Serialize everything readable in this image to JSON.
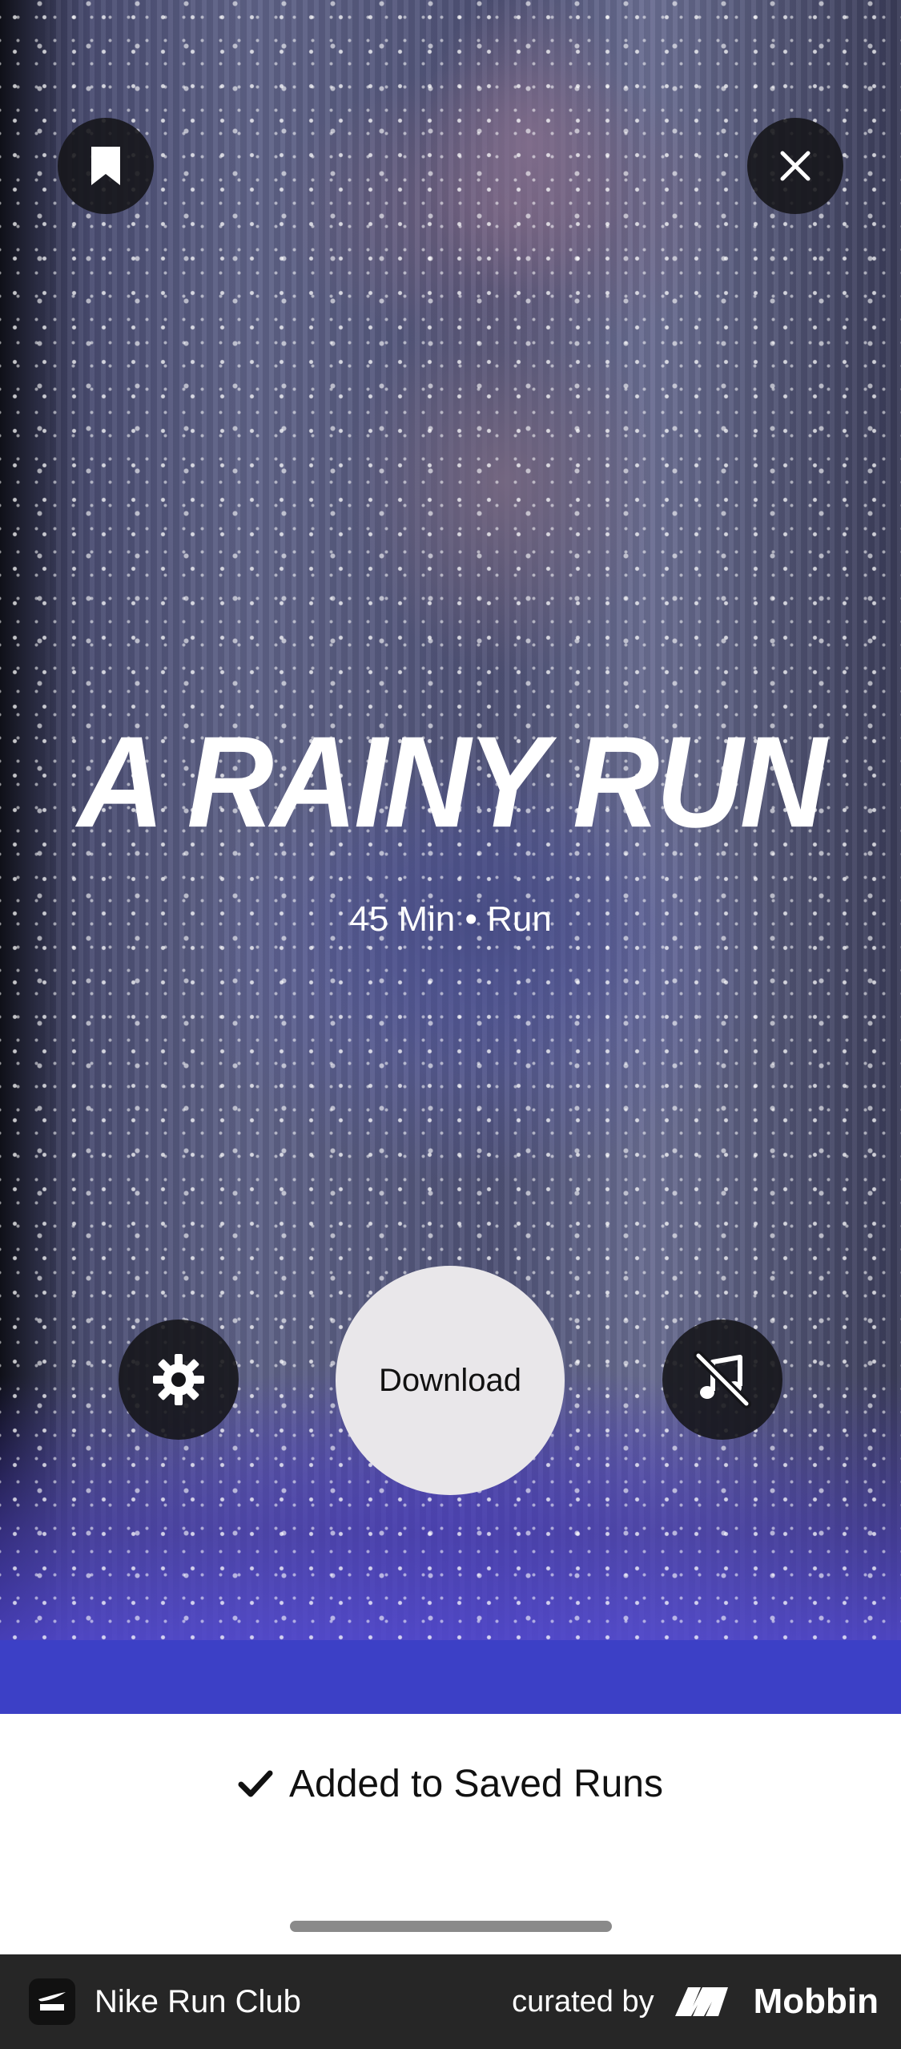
{
  "workout": {
    "title": "A RAINY RUN",
    "meta": "45 Min • Run"
  },
  "actions": {
    "download_label": "Download"
  },
  "toast": {
    "message": "Added to Saved Runs"
  },
  "footer": {
    "app_name": "Nike Run Club",
    "curated_by": "curated by",
    "brand": "Mobbin"
  },
  "colors": {
    "accent_blue": "#3c40c6",
    "footer_bg": "#262626"
  },
  "icons": [
    "bookmark-icon",
    "close-icon",
    "gear-icon",
    "music-off-icon",
    "checkmark-icon",
    "nrc-logo-icon",
    "mobbin-logo-icon"
  ]
}
